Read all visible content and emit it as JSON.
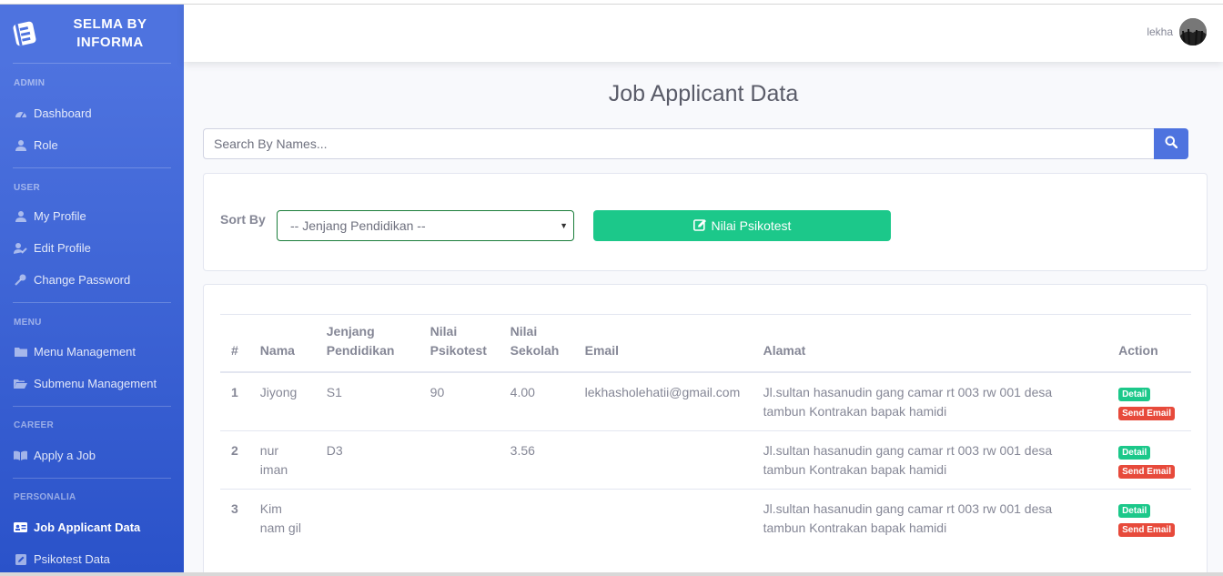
{
  "brand": {
    "line1": "SELMA BY",
    "line2": "INFORMA"
  },
  "sidebar": {
    "sections": [
      {
        "heading": "ADMIN",
        "items": [
          {
            "label": "Dashboard",
            "icon": "tachometer-icon"
          },
          {
            "label": "Role",
            "icon": "user-icon"
          }
        ]
      },
      {
        "heading": "USER",
        "items": [
          {
            "label": "My Profile",
            "icon": "user-icon"
          },
          {
            "label": "Edit Profile",
            "icon": "user-edit-icon"
          },
          {
            "label": "Change Password",
            "icon": "key-icon"
          }
        ]
      },
      {
        "heading": "MENU",
        "items": [
          {
            "label": "Menu Management",
            "icon": "folder-icon"
          },
          {
            "label": "Submenu Management",
            "icon": "folder-open-icon"
          }
        ]
      },
      {
        "heading": "CAREER",
        "items": [
          {
            "label": "Apply a Job",
            "icon": "book-icon"
          }
        ]
      },
      {
        "heading": "PERSONALIA",
        "items": [
          {
            "label": "Job Applicant Data",
            "icon": "id-card-icon",
            "active": true
          },
          {
            "label": "Psikotest Data",
            "icon": "edit-icon"
          }
        ]
      }
    ]
  },
  "topbar": {
    "user_name": "lekha"
  },
  "page": {
    "title": "Job Applicant Data"
  },
  "search": {
    "placeholder": "Search By Names..."
  },
  "filter": {
    "sort_label": "Sort By",
    "select_value": "-- Jenjang Pendidikan --",
    "button_label": "Nilai Psikotest"
  },
  "table": {
    "headers": [
      "#",
      "Nama",
      "Jenjang Pendidikan",
      "Nilai Psikotest",
      "Nilai Sekolah",
      "Email",
      "Alamat",
      "Action"
    ],
    "rows": [
      {
        "no": "1",
        "nama": "Jiyong",
        "jenjang": "S1",
        "psikotest": "90",
        "sekolah": "4.00",
        "email": "lekhasholehatii@gmail.com",
        "alamat": "Jl.sultan hasanudin gang camar rt 003 rw 001 desa tambun Kontrakan bapak hamidi"
      },
      {
        "no": "2",
        "nama": "nur iman",
        "jenjang": "D3",
        "psikotest": "",
        "sekolah": "3.56",
        "email": "",
        "alamat": "Jl.sultan hasanudin gang camar rt 003 rw 001 desa tambun Kontrakan bapak hamidi"
      },
      {
        "no": "3",
        "nama": "Kim nam gil",
        "jenjang": "",
        "psikotest": "",
        "sekolah": "",
        "email": "",
        "alamat": "Jl.sultan hasanudin gang camar rt 003 rw 001 desa tambun Kontrakan bapak hamidi"
      }
    ],
    "detail_label": "Detail",
    "send_email_label": "Send Email"
  }
}
